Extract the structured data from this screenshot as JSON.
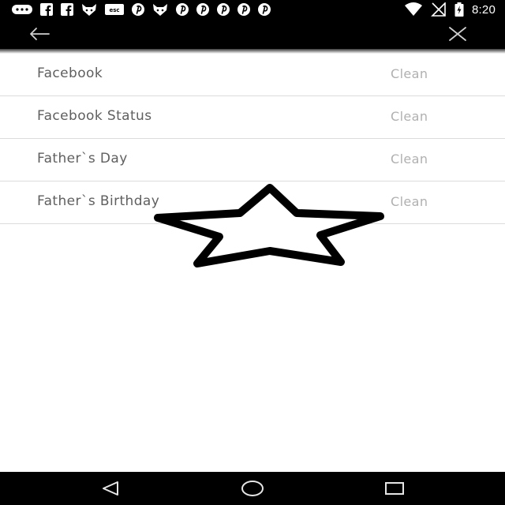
{
  "status_bar": {
    "time": "8:20",
    "notification_icons": [
      "messenger-icon",
      "facebook-icon",
      "facebook-icon",
      "fox-icon",
      "esc-icon",
      "pinterest-icon",
      "fox-icon",
      "pinterest-icon",
      "pinterest-icon",
      "pinterest-icon",
      "pinterest-icon",
      "pinterest-icon"
    ],
    "system_icons": [
      "wifi-icon",
      "signal-off-icon",
      "battery-charging-icon"
    ]
  },
  "app_bar": {
    "back_icon": "arrow-left-icon",
    "close_icon": "close-icon"
  },
  "list": {
    "items": [
      {
        "title": "Facebook",
        "action": "Clean"
      },
      {
        "title": "Facebook Status",
        "action": "Clean"
      },
      {
        "title": "Father`s Day",
        "action": "Clean"
      },
      {
        "title": "Father`s Birthday",
        "action": "Clean"
      }
    ]
  },
  "overlay": {
    "icon": "star-outline-icon"
  },
  "nav_bar": {
    "icons": [
      "back-triangle-icon",
      "home-circle-icon",
      "recents-square-icon"
    ]
  }
}
